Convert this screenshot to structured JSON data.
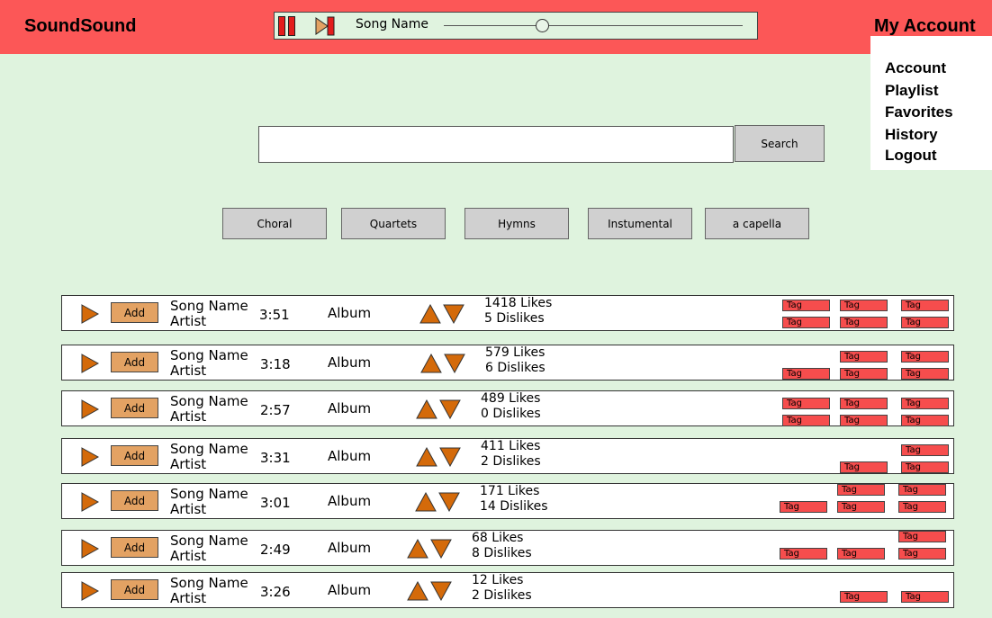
{
  "app": {
    "title": "SoundSound"
  },
  "player": {
    "song_name": "Song Name",
    "progress": 0.33
  },
  "account": {
    "title": "My Account",
    "menu": [
      "Account",
      "Playlist",
      "Favorites",
      "History",
      "Logout"
    ]
  },
  "search": {
    "value": "",
    "placeholder": "",
    "button_label": "Search"
  },
  "genres": [
    "Choral",
    "Quartets",
    "Hymns",
    "Instumental",
    "a capella"
  ],
  "colors": {
    "topbar": "#fc5757",
    "background": "#dff3de",
    "accent_orange": "#e3a263",
    "arrow_orange": "#d46a0a",
    "tag_red": "#f64d4d"
  },
  "songs": [
    {
      "name": "Song Name",
      "artist": "Artist",
      "duration": "3:51",
      "album": "Album",
      "likes": "1418 Likes",
      "dislikes": "5 Dislikes",
      "add_label": "Add",
      "tags": [
        "Tag",
        "Tag",
        "Tag",
        "Tag",
        "Tag",
        "Tag"
      ]
    },
    {
      "name": "Song Name",
      "artist": "Artist",
      "duration": "3:18",
      "album": "Album",
      "likes": "579 Likes",
      "dislikes": "6 Dislikes",
      "add_label": "Add",
      "tags": [
        "Tag",
        "Tag",
        "Tag",
        "Tag",
        "Tag"
      ]
    },
    {
      "name": "Song Name",
      "artist": "Artist",
      "duration": "2:57",
      "album": "Album",
      "likes": "489 Likes",
      "dislikes": "0 Dislikes",
      "add_label": "Add",
      "tags": [
        "Tag",
        "Tag",
        "Tag",
        "Tag",
        "Tag",
        "Tag"
      ]
    },
    {
      "name": "Song Name",
      "artist": "Artist",
      "duration": "3:31",
      "album": "Album",
      "likes": "411 Likes",
      "dislikes": "2 Dislikes",
      "add_label": "Add",
      "tags": [
        "Tag",
        "Tag",
        "Tag"
      ]
    },
    {
      "name": "Song Name",
      "artist": "Artist",
      "duration": "3:01",
      "album": "Album",
      "likes": "171 Likes",
      "dislikes": "14 Dislikes",
      "add_label": "Add",
      "tags": [
        "Tag",
        "Tag",
        "Tag",
        "Tag",
        "Tag"
      ]
    },
    {
      "name": "Song Name",
      "artist": "Artist",
      "duration": "2:49",
      "album": "Album",
      "likes": "68 Likes",
      "dislikes": "8 Dislikes",
      "add_label": "Add",
      "tags": [
        "Tag",
        "Tag",
        "Tag",
        "Tag"
      ]
    },
    {
      "name": "Song Name",
      "artist": "Artist",
      "duration": "3:26",
      "album": "Album",
      "likes": "12 Likes",
      "dislikes": "2 Dislikes",
      "add_label": "Add",
      "tags": [
        "Tag",
        "Tag"
      ]
    }
  ]
}
